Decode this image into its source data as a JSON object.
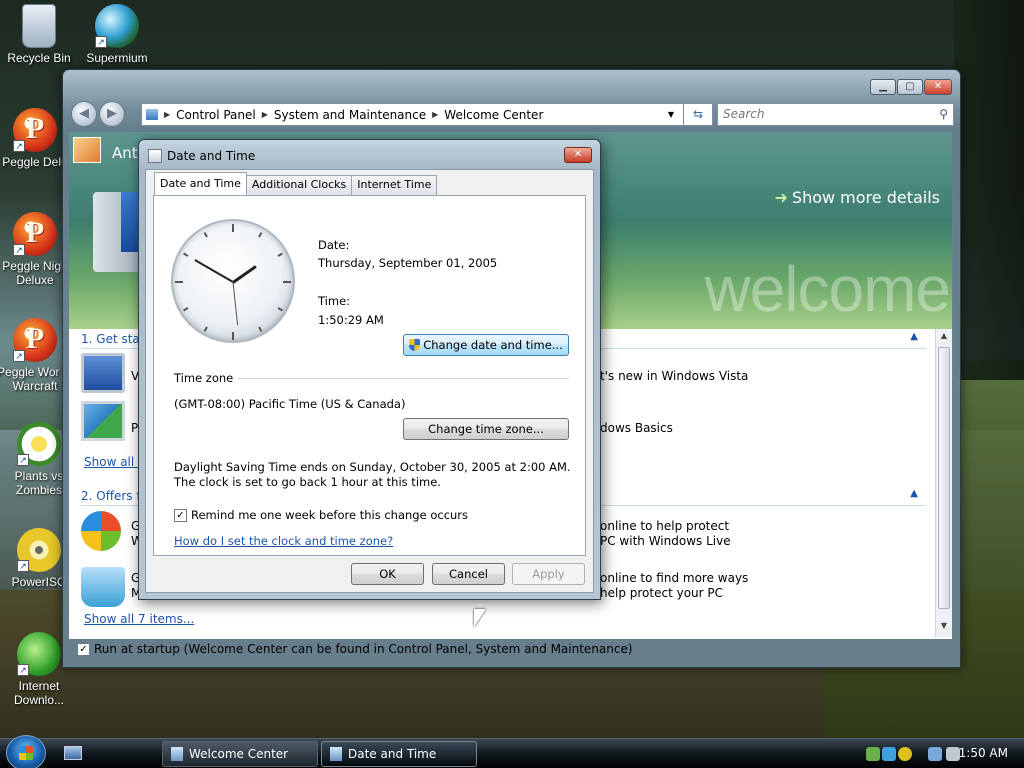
{
  "desktop": {
    "icons": [
      {
        "label": "Recycle Bin",
        "icon": "recycle-bin-icon"
      },
      {
        "label": "Supermium",
        "icon": "browser-icon"
      },
      {
        "label": "Peggle Delu",
        "icon": "peggle-icon"
      },
      {
        "label": "Peggle Nigh Deluxe",
        "icon": "peggle-icon"
      },
      {
        "label": "Peggle Wor of Warcraft",
        "icon": "peggle-icon"
      },
      {
        "label": "Plants vs Zombies",
        "icon": "flower-icon"
      },
      {
        "label": "PowerISO",
        "icon": "disc-icon"
      },
      {
        "label": "Internet Downlo...",
        "icon": "download-manager-icon"
      }
    ]
  },
  "main_window": {
    "breadcrumb": [
      "Control Panel",
      "System and Maintenance",
      "Welcome Center"
    ],
    "search_placeholder": "Search",
    "banner_title": "Anti",
    "show_more": "Show more details",
    "welcome_word": "welcome",
    "section1": "1. Get start",
    "section1_items": [
      {
        "left": "V",
        "right": "t's new in Windows Vista"
      },
      {
        "left": "P",
        "right": "dows Basics"
      }
    ],
    "show_all_1": "Show all 9",
    "section2": "2. Offers fr",
    "section2_items": [
      {
        "left": "G\nW",
        "right": "online to help protect\nPC with Windows Live"
      },
      {
        "left": "G\nM",
        "right": "online to find more ways\nhelp protect your PC"
      }
    ],
    "show_all_2": "Show all 7 items...",
    "run_at_startup": "Run at startup (Welcome Center can be found in Control Panel, System and Maintenance)"
  },
  "dialog": {
    "title": "Date and Time",
    "tabs": [
      "Date and Time",
      "Additional Clocks",
      "Internet Time"
    ],
    "active_tab": 0,
    "date_label": "Date:",
    "date_value": "Thursday, September 01, 2005",
    "time_label": "Time:",
    "time_value": "1:50:29 AM",
    "change_datetime_button": "Change date and time...",
    "timezone_heading": "Time zone",
    "timezone_value": "(GMT-08:00) Pacific Time (US & Canada)",
    "change_timezone_button": "Change time zone...",
    "dst_text": "Daylight Saving Time ends on Sunday, October 30, 2005 at 2:00 AM. The clock is set to go back 1 hour at this time.",
    "remind_label": "Remind me one week before this change occurs",
    "remind_checked": true,
    "help_link": "How do I set the clock and time zone?",
    "ok": "OK",
    "cancel": "Cancel",
    "apply": "Apply"
  },
  "taskbar": {
    "buttons": [
      "Welcome Center",
      "Date and Time"
    ],
    "clock": "1:50 AM"
  }
}
